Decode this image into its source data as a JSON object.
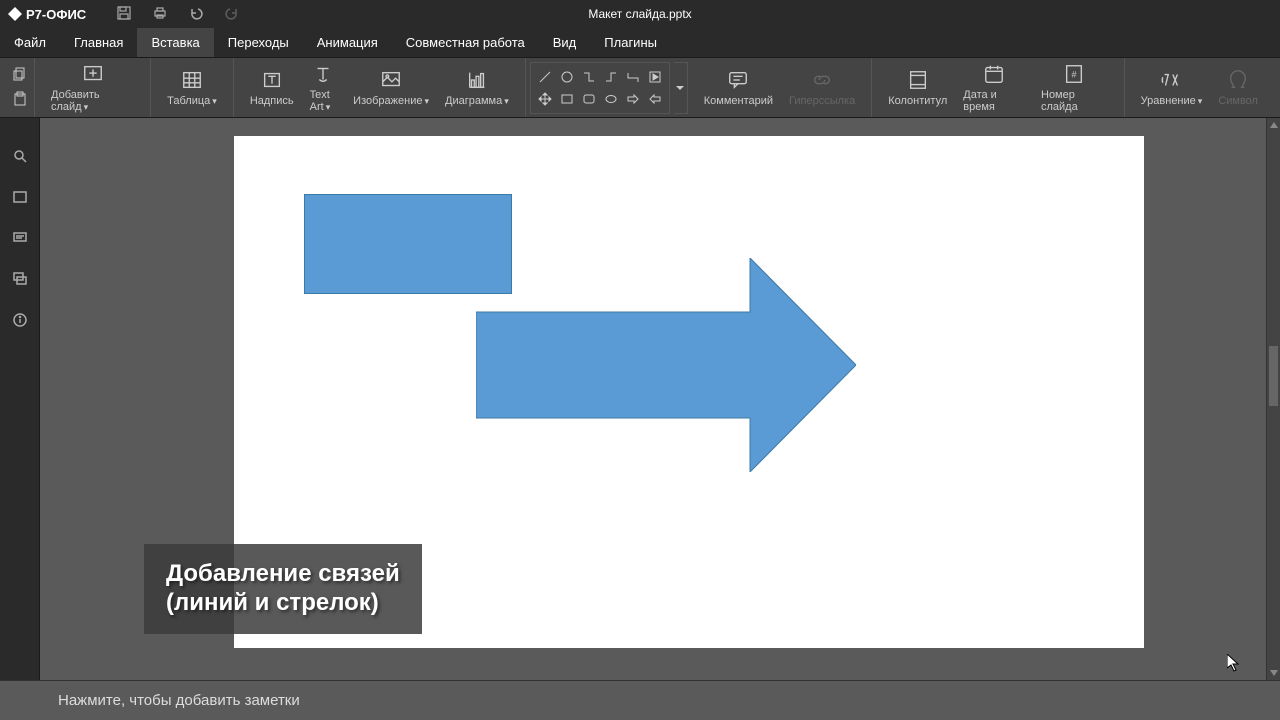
{
  "app_name": "Р7-ОФИС",
  "doc_title": "Макет слайда.pptx",
  "menu": {
    "file": "Файл",
    "home": "Главная",
    "insert": "Вставка",
    "transitions": "Переходы",
    "animation": "Анимация",
    "collaboration": "Совместная работа",
    "view": "Вид",
    "plugins": "Плагины"
  },
  "ribbon": {
    "add_slide": "Добавить слайд",
    "table": "Таблица",
    "textbox": "Надпись",
    "textart": "Text Art",
    "image": "Изображение",
    "chart": "Диаграмма",
    "comment": "Комментарий",
    "hyperlink": "Гиперссылка",
    "header_footer": "Колонтитул",
    "date_time": "Дата и время",
    "slide_number": "Номер слайда",
    "equation": "Уравнение",
    "symbol": "Символ"
  },
  "overlay": {
    "line1": "Добавление связей",
    "line2": "(линий и стрелок)"
  },
  "notes_placeholder": "Нажмите, чтобы добавить заметки",
  "shapes": {
    "fill": "#5b9bd5",
    "stroke": "#3d79a6"
  }
}
